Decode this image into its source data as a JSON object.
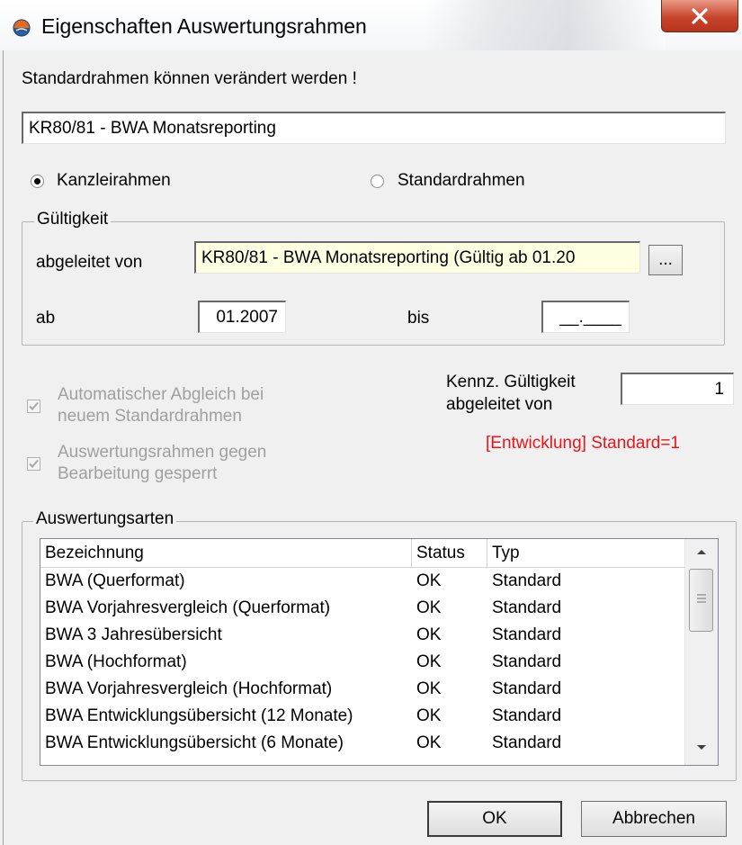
{
  "window": {
    "title": "Eigenschaften Auswertungsrahmen",
    "close_label": "X"
  },
  "info": {
    "message": "Standardrahmen können verändert werden !"
  },
  "name_field": {
    "value": "KR80/81 - BWA Monatsreporting"
  },
  "radio_group": {
    "kanzlei_label": "Kanzleirahmen",
    "kanzlei_selected": true,
    "standard_label": "Standardrahmen",
    "standard_selected": false
  },
  "gueltigkeit": {
    "group_title": "Gültigkeit",
    "abgeleitet_label": "abgeleitet von",
    "abgeleitet_value": "KR80/81 - BWA Monatsreporting (Gültig ab 01.20",
    "browse_label": "...",
    "ab_label": "ab",
    "ab_value": "01.2007",
    "bis_label": "bis",
    "bis_value": "__.____"
  },
  "options": {
    "auto_abgleich_label_1": "Automatischer Abgleich bei",
    "auto_abgleich_label_2": "neuem Standardrahmen",
    "gesperrt_label_1": "Auswertungsrahmen gegen",
    "gesperrt_label_2": "Bearbeitung gesperrt"
  },
  "kennz": {
    "label_1": "Kennz. Gültigkeit",
    "label_2": "abgeleitet von",
    "value": "1",
    "note": "[Entwicklung] Standard=1"
  },
  "auswertungsarten": {
    "group_title": "Auswertungsarten",
    "columns": [
      "Bezeichnung",
      "Status",
      "Typ"
    ],
    "rows": [
      [
        "BWA (Querformat)",
        "OK",
        "Standard"
      ],
      [
        "BWA Vorjahresvergleich (Querformat)",
        "OK",
        "Standard"
      ],
      [
        "BWA 3 Jahresübersicht",
        "OK",
        "Standard"
      ],
      [
        "BWA (Hochformat)",
        "OK",
        "Standard"
      ],
      [
        "BWA Vorjahresvergleich (Hochformat)",
        "OK",
        "Standard"
      ],
      [
        "BWA Entwicklungsübersicht (12 Monate)",
        "OK",
        "Standard"
      ],
      [
        "BWA Entwicklungsübersicht (6 Monate)",
        "OK",
        "Standard"
      ]
    ]
  },
  "buttons": {
    "ok": "OK",
    "cancel": "Abbrechen"
  },
  "colors": {
    "note_red": "#e8161b",
    "disabled_text": "#a0a0a0"
  }
}
